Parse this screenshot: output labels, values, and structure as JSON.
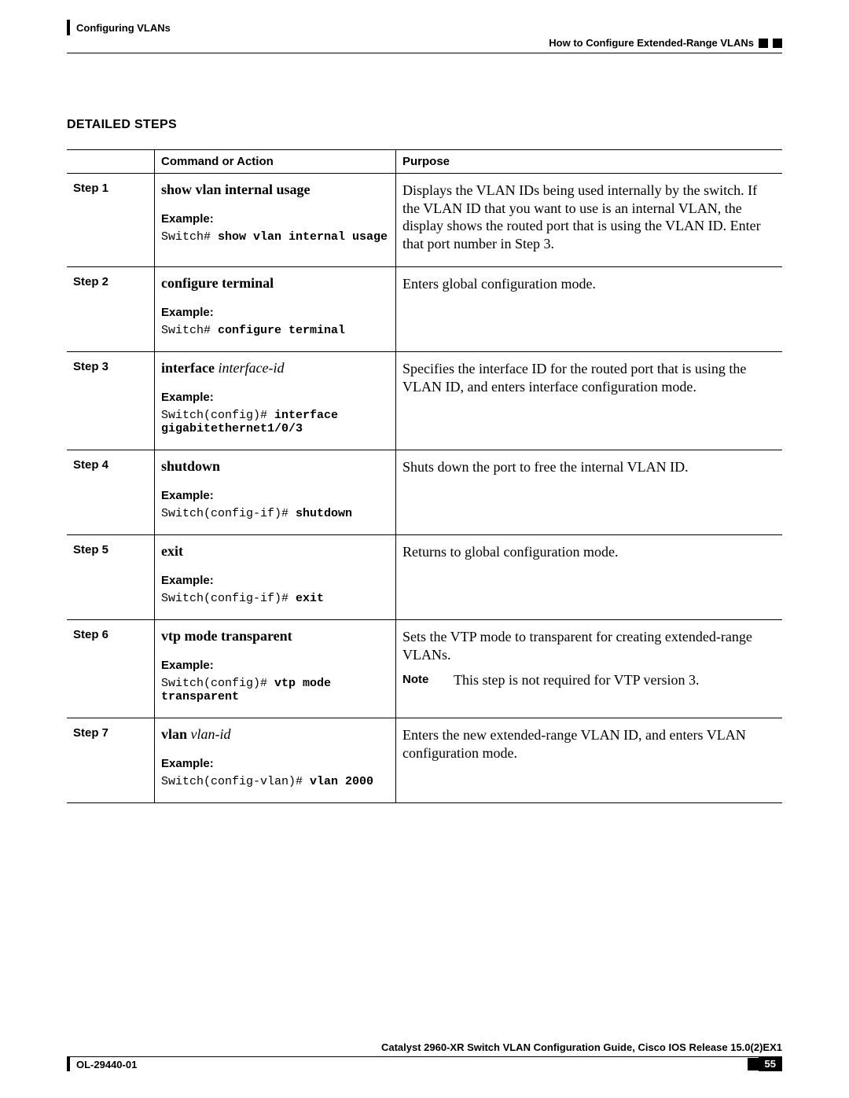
{
  "header": {
    "chapter": "Configuring VLANs",
    "topic": "How to Configure Extended-Range VLANs"
  },
  "section_title": "DETAILED STEPS",
  "table": {
    "head": {
      "col_cmd": "Command or Action",
      "col_purpose": "Purpose"
    },
    "rows": [
      {
        "step": "Step 1",
        "command_bold": "show vlan internal usage",
        "command_italic": "",
        "example_label": "Example:",
        "example_prompt": "Switch# ",
        "example_cmd": "show vlan internal usage",
        "purpose": "Displays the VLAN IDs being used internally by the switch. If the VLAN ID that you want to use is an internal VLAN, the display shows the routed port that is using the VLAN ID. Enter that port number in Step 3.",
        "note_label": "",
        "note_text": ""
      },
      {
        "step": "Step 2",
        "command_bold": "configure terminal",
        "command_italic": "",
        "example_label": "Example:",
        "example_prompt": "Switch# ",
        "example_cmd": "configure terminal",
        "purpose": "Enters global configuration mode.",
        "note_label": "",
        "note_text": ""
      },
      {
        "step": "Step 3",
        "command_bold": "interface",
        "command_italic": " interface-id",
        "example_label": "Example:",
        "example_prompt": "Switch(config)# ",
        "example_cmd": "interface gigabitethernet1/0/3",
        "purpose": "Specifies the interface ID for the routed port that is using the VLAN ID, and enters interface configuration mode.",
        "note_label": "",
        "note_text": ""
      },
      {
        "step": "Step 4",
        "command_bold": "shutdown",
        "command_italic": "",
        "example_label": "Example:",
        "example_prompt": "Switch(config-if)# ",
        "example_cmd": "shutdown",
        "purpose": "Shuts down the port to free the internal VLAN ID.",
        "note_label": "",
        "note_text": ""
      },
      {
        "step": "Step 5",
        "command_bold": "exit",
        "command_italic": "",
        "example_label": "Example:",
        "example_prompt": "Switch(config-if)# ",
        "example_cmd": "exit",
        "purpose": "Returns to global configuration mode.",
        "note_label": "",
        "note_text": ""
      },
      {
        "step": "Step 6",
        "command_bold": "vtp mode transparent",
        "command_italic": "",
        "example_label": "Example:",
        "example_prompt": "Switch(config)# ",
        "example_cmd": "vtp mode transparent",
        "purpose": "Sets the VTP mode to transparent for creating extended-range VLANs.",
        "note_label": "Note",
        "note_text": "This step is not required for VTP version 3."
      },
      {
        "step": "Step 7",
        "command_bold": "vlan",
        "command_italic": " vlan-id",
        "example_label": "Example:",
        "example_prompt": "Switch(config-vlan)# ",
        "example_cmd": "vlan 2000",
        "purpose": "Enters the new extended-range VLAN ID, and enters VLAN configuration mode.",
        "note_label": "",
        "note_text": ""
      }
    ]
  },
  "footer": {
    "book": "Catalyst 2960-XR Switch VLAN Configuration Guide, Cisco IOS Release 15.0(2)EX1",
    "docnum": "OL-29440-01",
    "page": "55"
  }
}
